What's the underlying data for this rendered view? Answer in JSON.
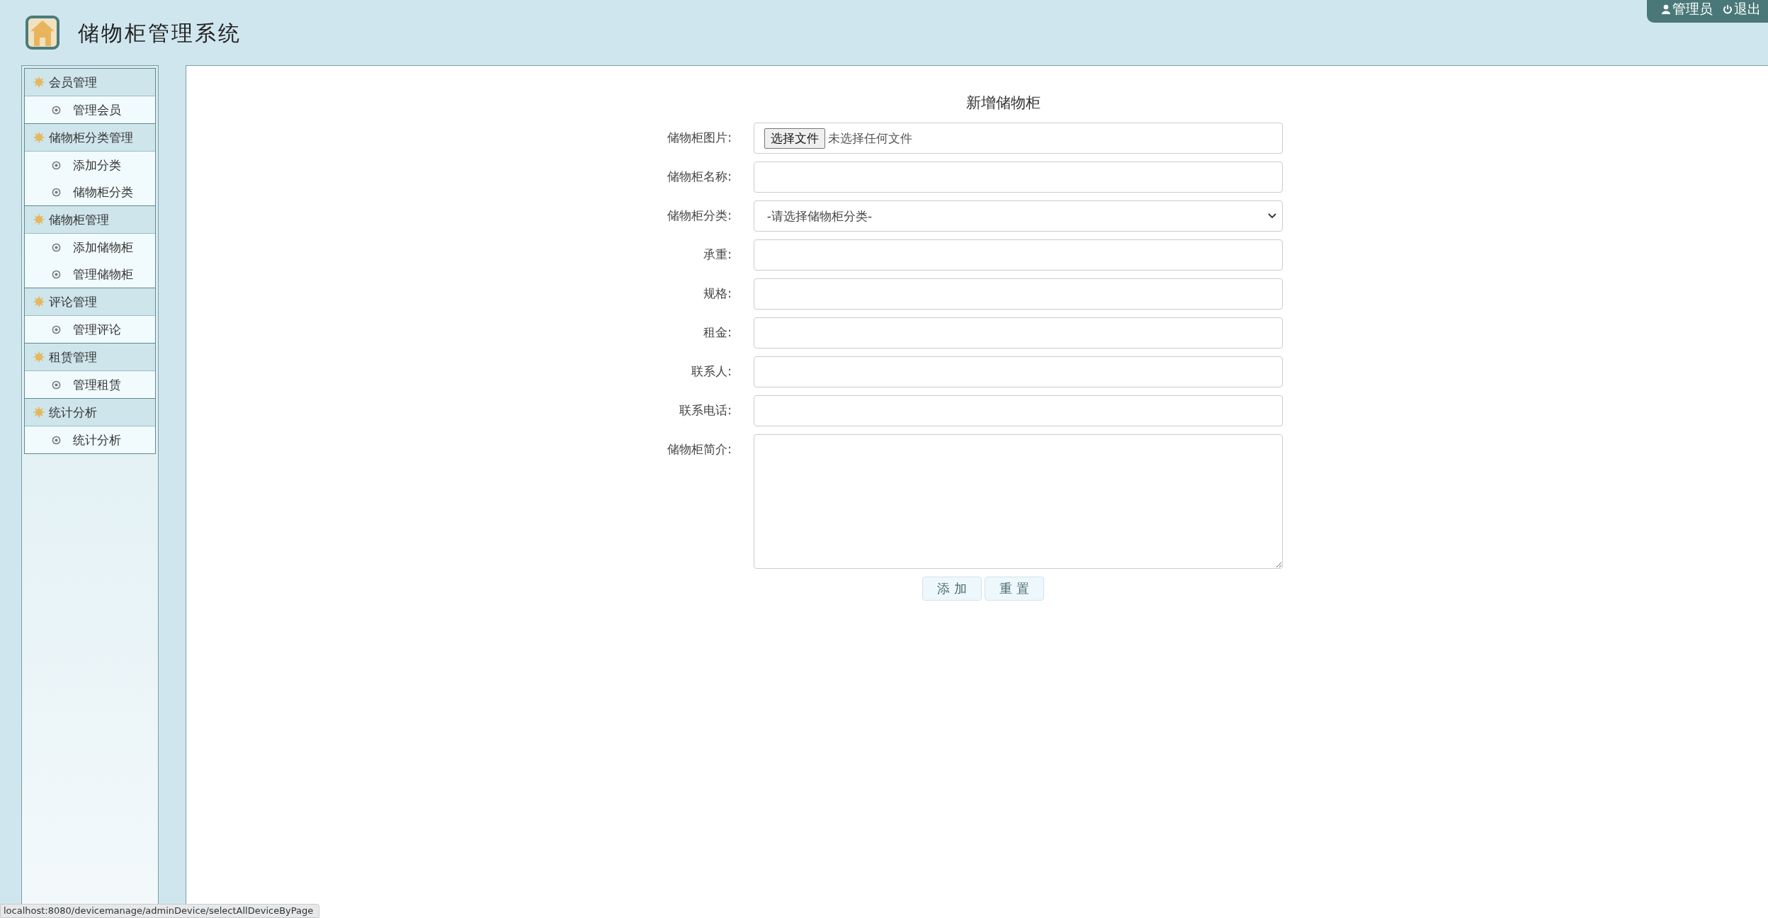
{
  "header": {
    "title": "储物柜管理系统",
    "user": "管理员",
    "logout": "退出"
  },
  "sidebar": {
    "groups": [
      {
        "label": "会员管理",
        "items": [
          "管理会员"
        ]
      },
      {
        "label": "储物柜分类管理",
        "items": [
          "添加分类",
          "储物柜分类"
        ]
      },
      {
        "label": "储物柜管理",
        "items": [
          "添加储物柜",
          "管理储物柜"
        ]
      },
      {
        "label": "评论管理",
        "items": [
          "管理评论"
        ]
      },
      {
        "label": "租赁管理",
        "items": [
          "管理租赁"
        ]
      },
      {
        "label": "统计分析",
        "items": [
          "统计分析"
        ]
      }
    ]
  },
  "form": {
    "title": "新增储物柜",
    "fields": [
      {
        "label": "储物柜图片:",
        "kind": "file",
        "button": "选择文件",
        "value": "未选择任何文件"
      },
      {
        "label": "储物柜名称:",
        "kind": "text"
      },
      {
        "label": "储物柜分类:",
        "kind": "select",
        "value": "-请选择储物柜分类-"
      },
      {
        "label": "承重:",
        "kind": "text"
      },
      {
        "label": "规格:",
        "kind": "text"
      },
      {
        "label": "租金:",
        "kind": "text"
      },
      {
        "label": "联系人:",
        "kind": "text"
      },
      {
        "label": "联系电话:",
        "kind": "text"
      },
      {
        "label": "储物柜简介:",
        "kind": "textarea"
      }
    ],
    "buttons": [
      "添 加",
      "重 置"
    ]
  },
  "status_bar": "localhost:8080/devicemanage/adminDevice/selectAllDeviceByPage"
}
